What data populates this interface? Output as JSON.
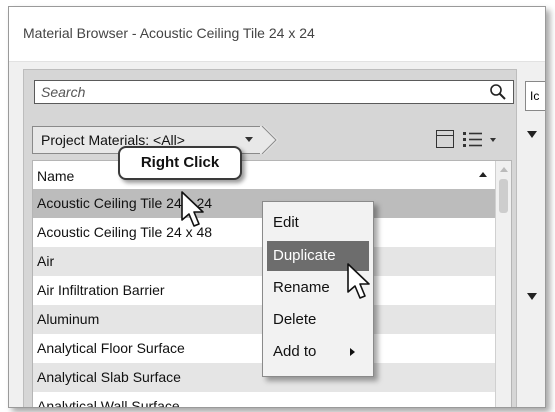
{
  "window": {
    "title": "Material Browser - Acoustic Ceiling Tile 24 x 24"
  },
  "search": {
    "placeholder": "Search"
  },
  "breadcrumb": {
    "label": "Project Materials: <All>"
  },
  "list": {
    "header": "Name",
    "rows": [
      "Acoustic Ceiling Tile 24 x 24",
      "Acoustic Ceiling Tile 24 x 48",
      "Air",
      "Air Infiltration Barrier",
      "Aluminum",
      "Analytical Floor Surface",
      "Analytical Slab Surface",
      "Analytical Wall Surface"
    ]
  },
  "right_panel": {
    "tab_label": "Ic"
  },
  "callout": {
    "text": "Right Click"
  },
  "context_menu": {
    "items": [
      "Edit",
      "Duplicate",
      "Rename",
      "Delete",
      "Add to"
    ]
  },
  "colors": {
    "selection": "#bcbcbc",
    "menu_highlight": "#6d6d6d"
  }
}
